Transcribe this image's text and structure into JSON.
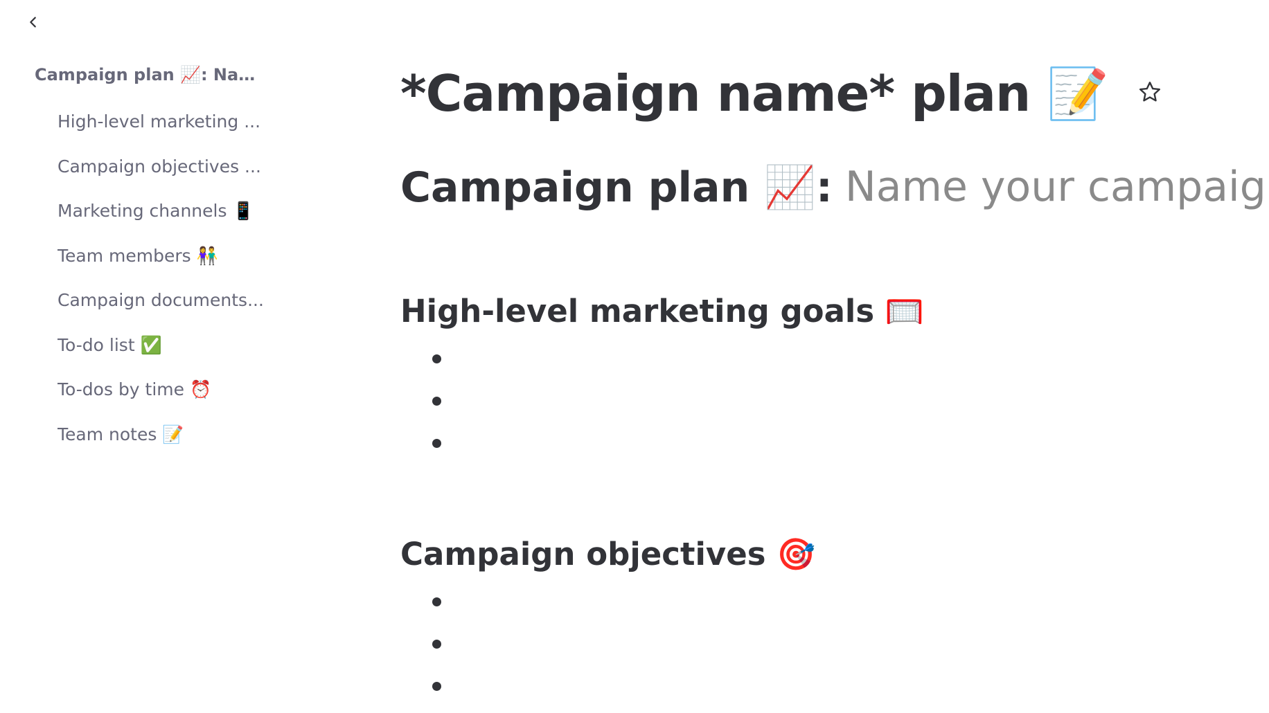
{
  "nav": {
    "back_icon": "chevron-left-icon"
  },
  "toc": {
    "title": "Campaign plan 📈: Nam...",
    "items": [
      {
        "label": "High-level marketing ..."
      },
      {
        "label": "Campaign objectives ..."
      },
      {
        "label": "Marketing channels 📱"
      },
      {
        "label": "Team members 👫"
      },
      {
        "label": "Campaign documents..."
      },
      {
        "label": "To-do list ✅"
      },
      {
        "label": "To-dos by time ⏰"
      },
      {
        "label": "Team notes 📝"
      }
    ]
  },
  "doc": {
    "title": "*Campaign name* plan 📝",
    "star_icon": "star-outline-icon",
    "heading": {
      "label": "Campaign plan 📈:",
      "placeholder": "Name your campaign"
    },
    "sections": [
      {
        "heading": "High-level marketing goals 🥅",
        "bullets": [
          "",
          "",
          ""
        ]
      },
      {
        "heading": "Campaign objectives 🎯",
        "bullets": [
          "",
          "",
          ""
        ]
      }
    ]
  }
}
